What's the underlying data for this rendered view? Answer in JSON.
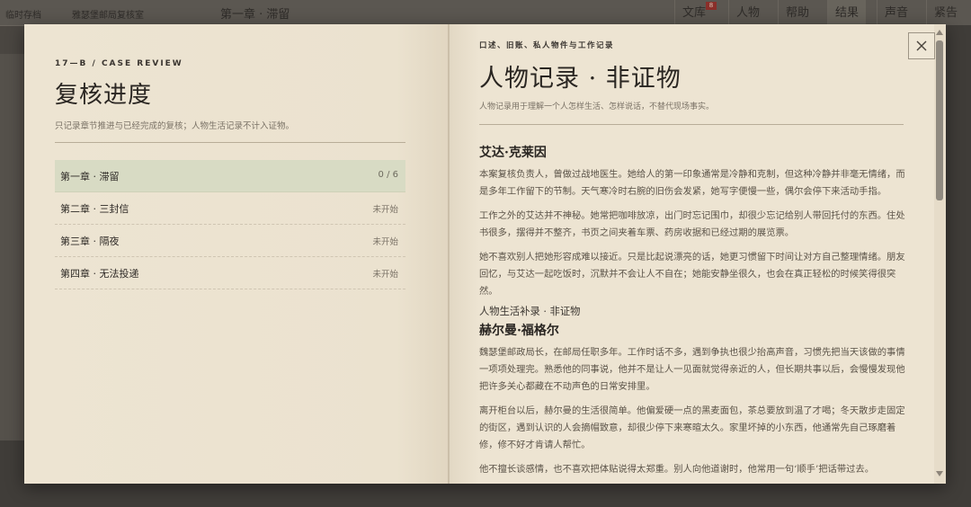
{
  "background": {
    "top_left_text": "临时存档",
    "top_case_text": "雅瑟堡邮局复核室",
    "top_chapter_text": "第一章 · 滞留",
    "nav": [
      {
        "label": "文库",
        "badge": "8"
      },
      {
        "label": "人物"
      },
      {
        "label": "帮助"
      },
      {
        "label": "结果"
      },
      {
        "label": "声音"
      },
      {
        "label": "紧告"
      }
    ]
  },
  "left": {
    "eyebrow": "17—B / CASE REVIEW",
    "title": "复核进度",
    "subtitle": "只记录章节推进与已经完成的复核；人物生活记录不计入证物。",
    "chapters": [
      {
        "name": "第一章 · 滞留",
        "status": "0 / 6",
        "active": true
      },
      {
        "name": "第二章 · 三封信",
        "status": "未开始"
      },
      {
        "name": "第三章 · 隔夜",
        "status": "未开始"
      },
      {
        "name": "第四章 · 无法投递",
        "status": "未开始"
      }
    ]
  },
  "right": {
    "eyebrow": "口述、旧账、私人物件与工作记录",
    "title": "人物记录 · 非证物",
    "subtitle": "人物记录用于理解一个人怎样生活、怎样说话，不替代现场事实。",
    "people": [
      {
        "name": "艾达·克莱因",
        "paragraphs": [
          "本案复核负责人，曾做过战地医生。她给人的第一印象通常是冷静和克制，但这种冷静并非毫无情绪，而是多年工作留下的节制。天气寒冷时右腕的旧伤会发紧，她写字便慢一些，偶尔会停下来活动手指。",
          "工作之外的艾达并不神秘。她常把咖啡放凉，出门时忘记围巾，却很少忘记给别人带回托付的东西。住处书很多，摆得并不整齐，书页之间夹着车票、药房收据和已经过期的展览票。",
          "她不喜欢别人把她形容成难以接近。只是比起说漂亮的话，她更习惯留下时间让对方自己整理情绪。朋友回忆，与艾达一起吃饭时，沉默并不会让人不自在；她能安静坐很久，也会在真正轻松的时候笑得很突然。"
        ],
        "supplement": "人物生活补录 · 非证物"
      },
      {
        "name": "赫尔曼·福格尔",
        "paragraphs": [
          "魏瑟堡邮政局长，在邮局任职多年。工作时话不多，遇到争执也很少抬高声音，习惯先把当天该做的事情一项项处理完。熟悉他的同事说，他并不是让人一见面就觉得亲近的人，但长期共事以后，会慢慢发现他把许多关心都藏在不动声色的日常安排里。",
          "离开柜台以后，赫尔曼的生活很简单。他偏爱硬一点的黑麦面包，茶总要放到温了才喝；冬天散步走固定的街区，遇到认识的人会摘帽致意，却很少停下来寒暄太久。家里坏掉的小东西，他通常先自己琢磨着修，修不好才肯请人帮忙。",
          "他不擅长谈感情，也不喜欢把体贴说得太郑重。别人向他道谢时，他常用一句‘顺手’把话带过去。"
        ]
      }
    ]
  }
}
